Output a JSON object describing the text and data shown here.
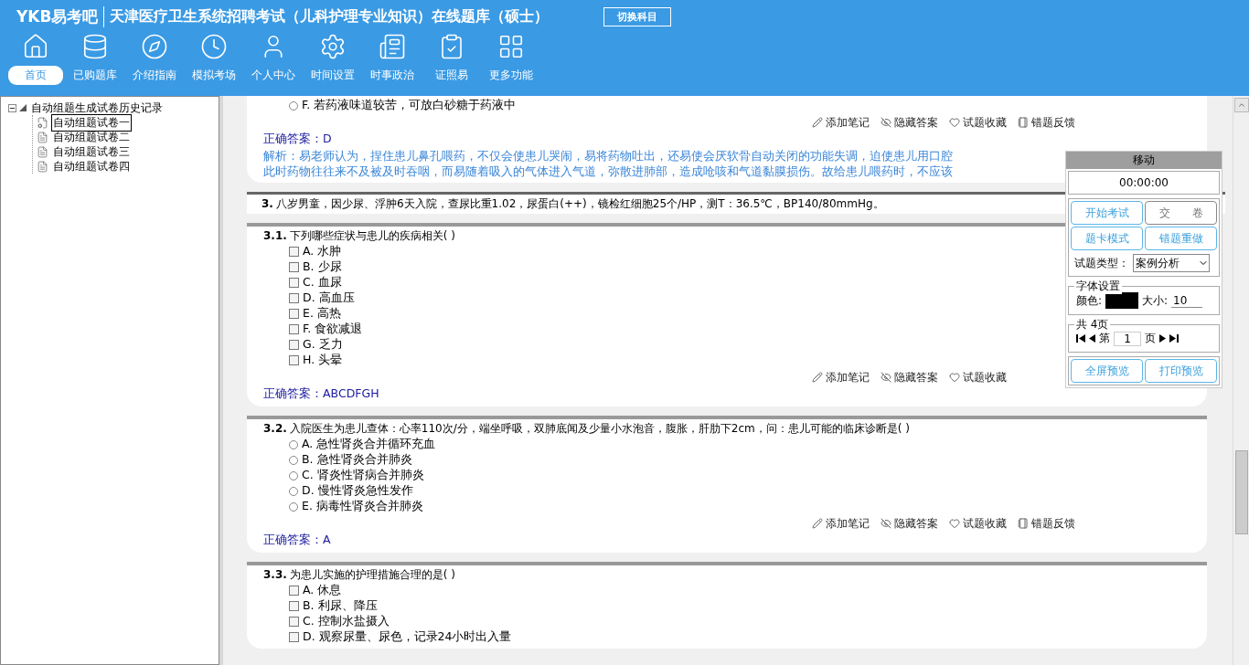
{
  "header": {
    "logo": "YKB易考吧",
    "title": "天津医疗卫生系统招聘考试（儿科护理专业知识）在线题库（硕士）",
    "switch_button": "切换科目"
  },
  "nav": [
    {
      "label": "首页",
      "selected": true
    },
    {
      "label": "已购题库",
      "selected": false
    },
    {
      "label": "介绍指南",
      "selected": false
    },
    {
      "label": "模拟考场",
      "selected": false
    },
    {
      "label": "个人中心",
      "selected": false
    },
    {
      "label": "时间设置",
      "selected": false
    },
    {
      "label": "时事政治",
      "selected": false
    },
    {
      "label": "证照易",
      "selected": false
    },
    {
      "label": "更多功能",
      "selected": false
    }
  ],
  "tree": {
    "label": "自动组题生成试卷历史记录",
    "expanded": true,
    "children": [
      {
        "label": "自动组题试卷一",
        "selected": true
      },
      {
        "label": "自动组题试卷二",
        "selected": false
      },
      {
        "label": "自动组题试卷三",
        "selected": false
      },
      {
        "label": "自动组题试卷四",
        "selected": false
      }
    ]
  },
  "blocks": [
    {
      "kind": "tail",
      "options": [
        {
          "text": "F. 若药液味道较苦，可放白砂糖于药液中",
          "selected": false
        }
      ],
      "actions": [
        "添加笔记",
        "隐藏答案",
        "试题收藏",
        "错题反馈"
      ],
      "answer_label": "正确答案：",
      "answer": "D",
      "analysis": [
        "解析：易老师认为，捏住患儿鼻孔喂药，不仅会使患儿哭闹，易将药物吐出，还易使会厌软骨自动关闭的功能失调，迫使患儿用口腔",
        "此时药物往往来不及被及时吞咽，而易随着吸入的气体进入气道，弥散进肺部，造成呛咳和气道黏膜损伤。故给患儿喂药时，不应该"
      ]
    },
    {
      "kind": "case",
      "number": "3.",
      "text": "八岁男童，因少尿、浮肿6天入院，查尿比重1.02，尿蛋白(++)，镜检红细胞25个/HP，测T：36.5℃，BP140/80mmHg。"
    },
    {
      "kind": "question",
      "number": "3.1.",
      "text": "下列哪些症状与患儿的疾病相关( )",
      "options": [
        {
          "text": "A. 水肿",
          "checked": false
        },
        {
          "text": "B. 少尿",
          "checked": false
        },
        {
          "text": "C. 血尿",
          "checked": false
        },
        {
          "text": "D. 高血压",
          "checked": false
        },
        {
          "text": "E. 高热",
          "checked": false
        },
        {
          "text": "F. 食欲减退",
          "checked": false
        },
        {
          "text": "G. 乏力",
          "checked": false
        },
        {
          "text": "H. 头晕",
          "checked": false
        }
      ],
      "actions": [
        "添加笔记",
        "隐藏答案",
        "试题收藏"
      ],
      "answer_label": "正确答案：",
      "answer": "ABCDFGH"
    },
    {
      "kind": "question",
      "number": "3.2.",
      "text": "入院医生为患儿查体：心率110次/分，端坐呼吸，双肺底闻及少量小水泡音，腹胀，肝肋下2cm，问：患儿可能的临床诊断是( )",
      "options": [
        {
          "text": "A. 急性肾炎合并循环充血",
          "selected": false
        },
        {
          "text": "B. 急性肾炎合并肺炎",
          "selected": false
        },
        {
          "text": "C. 肾炎性肾病合并肺炎",
          "selected": false
        },
        {
          "text": "D. 慢性肾炎急性发作",
          "selected": false
        },
        {
          "text": "E. 病毒性肾炎合并肺炎",
          "selected": false
        }
      ],
      "actions": [
        "添加笔记",
        "隐藏答案",
        "试题收藏",
        "错题反馈"
      ],
      "answer_label": "正确答案：",
      "answer": "A"
    },
    {
      "kind": "question",
      "number": "3.3.",
      "text": "为患儿实施的护理措施合理的是( )",
      "options": [
        {
          "text": "A. 休息",
          "checked": false
        },
        {
          "text": "B. 利尿、降压",
          "checked": false
        },
        {
          "text": "C. 控制水盐摄入",
          "checked": false
        },
        {
          "text": "D. 观察尿量、尿色，记录24小时出入量",
          "checked": false
        }
      ]
    }
  ],
  "panel": {
    "title": "移动",
    "timer": "00:00:00",
    "buttons": [
      {
        "label": "开始考试",
        "kind": "primary"
      },
      {
        "label": "交　　卷",
        "kind": "plain"
      },
      {
        "label": "题卡模式",
        "kind": "primary"
      },
      {
        "label": "错题重做",
        "kind": "primary"
      }
    ],
    "type_label": "试题类型：",
    "type_value": "案例分析",
    "font_group": "字体设置",
    "color_label": "颜色:",
    "color": "#000000",
    "size_label": "大小:",
    "size_value": "10",
    "page_group": "共 4页",
    "page_prefix": "第",
    "page_value": "1",
    "page_suffix": "页",
    "bottom_buttons": [
      "全屏预览",
      "打印预览"
    ]
  }
}
